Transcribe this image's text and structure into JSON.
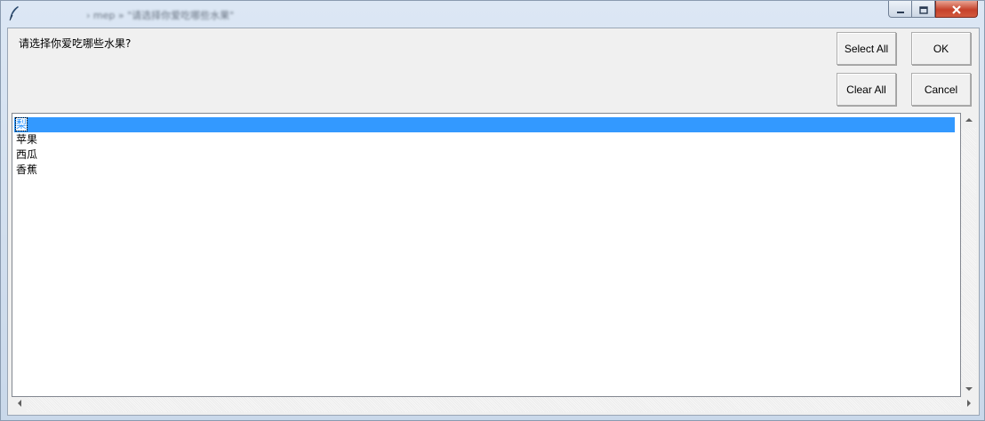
{
  "window": {
    "title": "› mep » \"请选择你爱吃哪些水果\""
  },
  "dialog": {
    "prompt": "请选择你爱吃哪些水果?",
    "buttons": {
      "select_all": "Select All",
      "ok": "OK",
      "clear_all": "Clear All",
      "cancel": "Cancel"
    },
    "items": [
      {
        "label": "梨",
        "selected": true
      },
      {
        "label": "苹果",
        "selected": false
      },
      {
        "label": "西瓜",
        "selected": false
      },
      {
        "label": "香蕉",
        "selected": false
      }
    ]
  },
  "icons": {
    "app": "feather-icon",
    "minimize": "minimize-icon",
    "maximize": "maximize-icon",
    "close": "close-icon",
    "scroll_up": "arrow-up-icon",
    "scroll_down": "arrow-down-icon",
    "scroll_left": "arrow-left-icon",
    "scroll_right": "arrow-right-icon"
  },
  "colors": {
    "selection": "#3399ff",
    "close_button": "#c6422b",
    "dialog_bg": "#f0f0f0"
  }
}
